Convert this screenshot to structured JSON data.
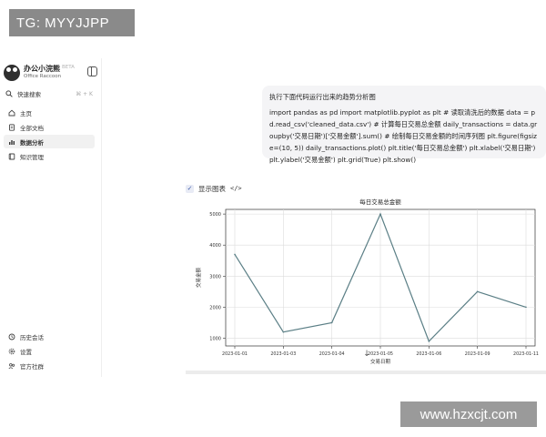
{
  "watermarks": {
    "top": "TG: MYYJJPP",
    "bottom": "www.hzxcjt.com"
  },
  "sidebar": {
    "brand_name": "办公小浣熊",
    "brand_badge": "BETA",
    "brand_sub": "Office Raccoon",
    "search_label": "快速搜索",
    "search_shortcut": "⌘ + K",
    "items": [
      {
        "label": "主页",
        "icon": "home-icon"
      },
      {
        "label": "全部文档",
        "icon": "document-icon"
      },
      {
        "label": "数据分析",
        "icon": "bar-chart-icon",
        "active": true
      },
      {
        "label": "知识管理",
        "icon": "book-icon"
      }
    ],
    "bottom_items": [
      {
        "label": "历史会话",
        "icon": "history-icon"
      },
      {
        "label": "设置",
        "icon": "gear-icon"
      },
      {
        "label": "官方社群",
        "icon": "community-icon"
      }
    ]
  },
  "prompt": {
    "title": "执行下面代码运行出来的趋势分析图",
    "code": "import pandas as pd import matplotlib.pyplot as plt # 读取清洗后的数据 data = pd.read_csv('cleaned_data.csv') # 计算每日交易总金额 daily_transactions = data.groupby('交易日期')['交易金额'].sum() # 绘制每日交易金额的时间序列图 plt.figure(figsize=(10, 5)) daily_transactions.plot() plt.title('每日交易总金额') plt.xlabel('交易日期') plt.ylabel('交易金额') plt.grid(True) plt.show()"
  },
  "chart_toggle": {
    "label": "显示图表",
    "checked": true
  },
  "chart_data": {
    "type": "line",
    "title": "每日交易总金额",
    "xlabel": "交易日期",
    "ylabel": "交易金额",
    "x": [
      "2023-01-01",
      "2023-01-03",
      "2023-01-04",
      "2023-01-05",
      "2023-01-06",
      "2023-01-09",
      "2023-01-11"
    ],
    "y": [
      3700,
      1200,
      1500,
      5000,
      900,
      2500,
      2000
    ],
    "yticks": [
      1000,
      2000,
      3000,
      4000,
      5000
    ],
    "ylim": [
      750,
      5150
    ],
    "grid": true,
    "line_color": "#5b7f86"
  }
}
